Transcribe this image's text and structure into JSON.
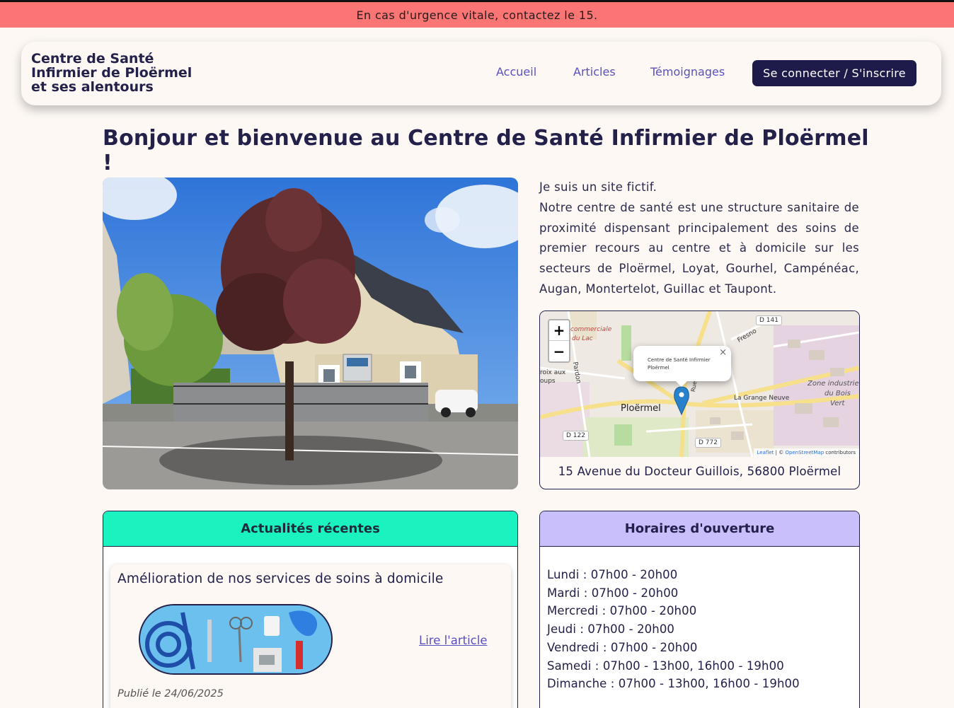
{
  "alert": {
    "text": "En cas d'urgence vitale, contactez le 15."
  },
  "header": {
    "brand_line1": "Centre de Santé",
    "brand_line2": "Infirmier de Ploërmel",
    "brand_line3": "et ses alentours",
    "nav": {
      "home": "Accueil",
      "articles": "Articles",
      "testimonials": "Témoignages"
    },
    "login_label": "Se connecter / S'inscrire"
  },
  "main": {
    "title": "Bonjour et bienvenue au Centre de Santé Infirmier de Ploërmel !",
    "intro_line1": "Je suis un site fictif.",
    "intro_paragraph": "Notre centre de santé est une structure sanitaire de proximité dispensant principalement des soins de premier recours au centre et à domicile sur les secteurs de Ploërmel, Loyat, Gourhel, Campénéac, Augan, Montertelot, Guillac et Taupont."
  },
  "map": {
    "zoom_in": "+",
    "zoom_out": "−",
    "popup_text": "Centre de Santé Infirmier Ploërmel",
    "popup_close": "×",
    "city_label": "Ploërmel",
    "zone_label_1": "Zone industrie",
    "zone_label_2": "du Bois",
    "zone_label_3": "Vert",
    "commercial_label_1": "commerciale",
    "commercial_label_2": "du Lac",
    "grange_label": "La Grange Neuve",
    "croix_label_1": "roix aux",
    "croix_label_2": "oups",
    "road_d141": "D 141",
    "road_d122": "D 122",
    "road_d772": "D 772",
    "fresno_label": "Fresno",
    "pardon_label": "Pardon",
    "rue_label": "Rue",
    "attribution_leaflet": "Leaflet",
    "attribution_rest": "| ©",
    "attribution_osm": "OpenStreetMap",
    "attribution_end": "contributors",
    "address": "15 Avenue du Docteur Guillois, 56800 Ploërmel"
  },
  "news": {
    "header": "Actualités récentes",
    "article_title": "Amélioration de nos services de soins à domicile",
    "read_link": "Lire l'article",
    "published": "Publié le 24/06/2025"
  },
  "hours": {
    "header": "Horaires d'ouverture",
    "items": [
      "Lundi : 07h00 - 20h00",
      "Mardi : 07h00 - 20h00",
      "Mercredi : 07h00 - 20h00",
      "Jeudi : 07h00 - 20h00",
      "Vendredi : 07h00 - 20h00",
      "Samedi : 07h00 - 13h00, 16h00 - 19h00",
      "Dimanche : 07h00 - 13h00, 16h00 - 19h00"
    ]
  },
  "colors": {
    "alert_bg": "#fb7575",
    "primary_dark": "#1e1b4b",
    "nav_link": "#5a4fbf",
    "news_header_bg": "#1af2bf",
    "hours_header_bg": "#c8bffb",
    "page_bg": "#fdf8f4"
  },
  "icons": {
    "map_marker": "map-marker-icon"
  }
}
